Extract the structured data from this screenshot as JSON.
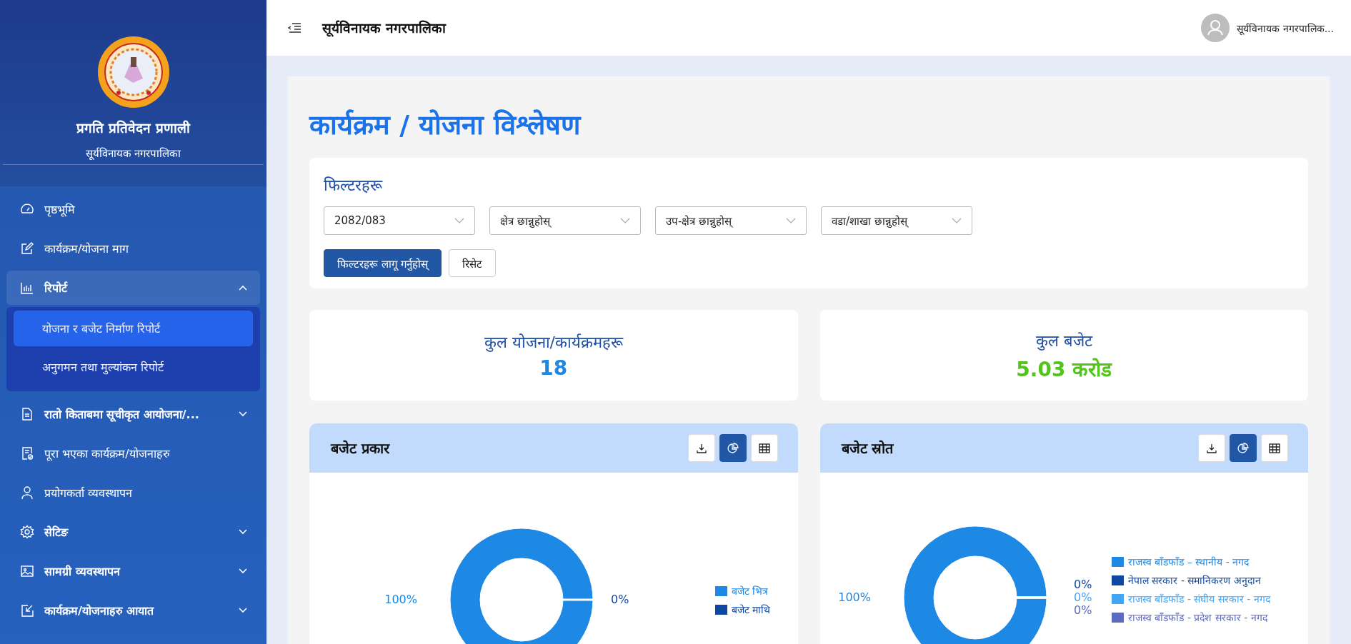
{
  "sidebar": {
    "app_title": "प्रगति प्रतिवेदन प्रणाली",
    "org_name": "सूर्यविनायक नगरपालिका",
    "items": [
      {
        "label": "पृष्ठभूमि",
        "selected": false
      },
      {
        "label": "कार्यक्रम/योजना माग",
        "selected": false
      },
      {
        "label": "रिपोर्ट",
        "selected": true,
        "expanded": true,
        "children": [
          {
            "label": "योजना र बजेट निर्माण रिपोर्ट",
            "selected": true
          },
          {
            "label": "अनुगमन तथा मुल्यांकन रिपोर्ट",
            "selected": false
          }
        ]
      },
      {
        "label": "रातो किताबमा सूचीकृत आयोजना/...",
        "selected": false,
        "expanded": false
      },
      {
        "label": "पूरा भएका कार्यक्रम/योजनाहरु",
        "selected": false
      },
      {
        "label": "प्रयोगकर्ता व्यवस्थापन",
        "selected": false
      },
      {
        "label": "सेटिङ",
        "selected": false,
        "expanded": false
      },
      {
        "label": "सामग्री व्यवस्थापन",
        "selected": false,
        "expanded": false
      },
      {
        "label": "कार्यक्रम/योजनाहरु आयात",
        "selected": false,
        "expanded": false
      }
    ]
  },
  "header": {
    "title": "सूर्यविनायक नगरपालिका",
    "user_name": "सूर्यविनायक नगरपालिक..."
  },
  "page_title": "कार्यक्रम / योजना विश्लेषण",
  "filters": {
    "title": "फिल्टरहरू",
    "selects": [
      {
        "value": "2082/083"
      },
      {
        "placeholder": "क्षेत्र छान्नुहोस्"
      },
      {
        "placeholder": "उप-क्षेत्र छान्नुहोस्"
      },
      {
        "placeholder": "वडा/शाखा छान्नुहोस्"
      }
    ],
    "apply_button": "फिल्टरहरू लागू गर्नुहोस्",
    "reset_button": "रिसेट"
  },
  "stats": [
    {
      "label": "कुल योजना/कार्यक्रमहरू",
      "value": "18",
      "color": "#1e88e5"
    },
    {
      "label": "कुल बजेट",
      "value": "5.03 करोड",
      "color": "#52c41a"
    }
  ],
  "charts": [
    {
      "title": "बजेट प्रकार",
      "view_buttons": [
        {
          "kind": "download",
          "selected": false
        },
        {
          "kind": "pie",
          "selected": true
        },
        {
          "kind": "table",
          "selected": false
        }
      ],
      "chart_data": {
        "type": "pie",
        "categories": [
          "बजेट भित्र",
          "बजेट माथि"
        ],
        "values": [
          100,
          0
        ],
        "colors": [
          "#1e88e5",
          "#0d47a1"
        ],
        "value_labels": [
          "100%",
          "0%"
        ]
      }
    },
    {
      "title": "बजेट स्रोत",
      "view_buttons": [
        {
          "kind": "download",
          "selected": false
        },
        {
          "kind": "pie",
          "selected": true
        },
        {
          "kind": "table",
          "selected": false
        }
      ],
      "chart_data": {
        "type": "pie",
        "categories": [
          "राजस्व बाँडफाँड – स्थानीय - नगद",
          "नेपाल सरकार - समानिकरण अनुदान",
          "राजस्व बाँडफाँड - संघीय सरकार - नगद",
          "राजस्व बाँडफाँड - प्रदेश सरकार - नगद"
        ],
        "values": [
          100,
          0,
          0,
          0
        ],
        "colors": [
          "#1e88e5",
          "#0d47a1",
          "#42a5f5",
          "#5c6bc0"
        ],
        "value_labels": [
          "100%",
          "0%",
          "0%",
          "0%"
        ]
      }
    }
  ]
}
